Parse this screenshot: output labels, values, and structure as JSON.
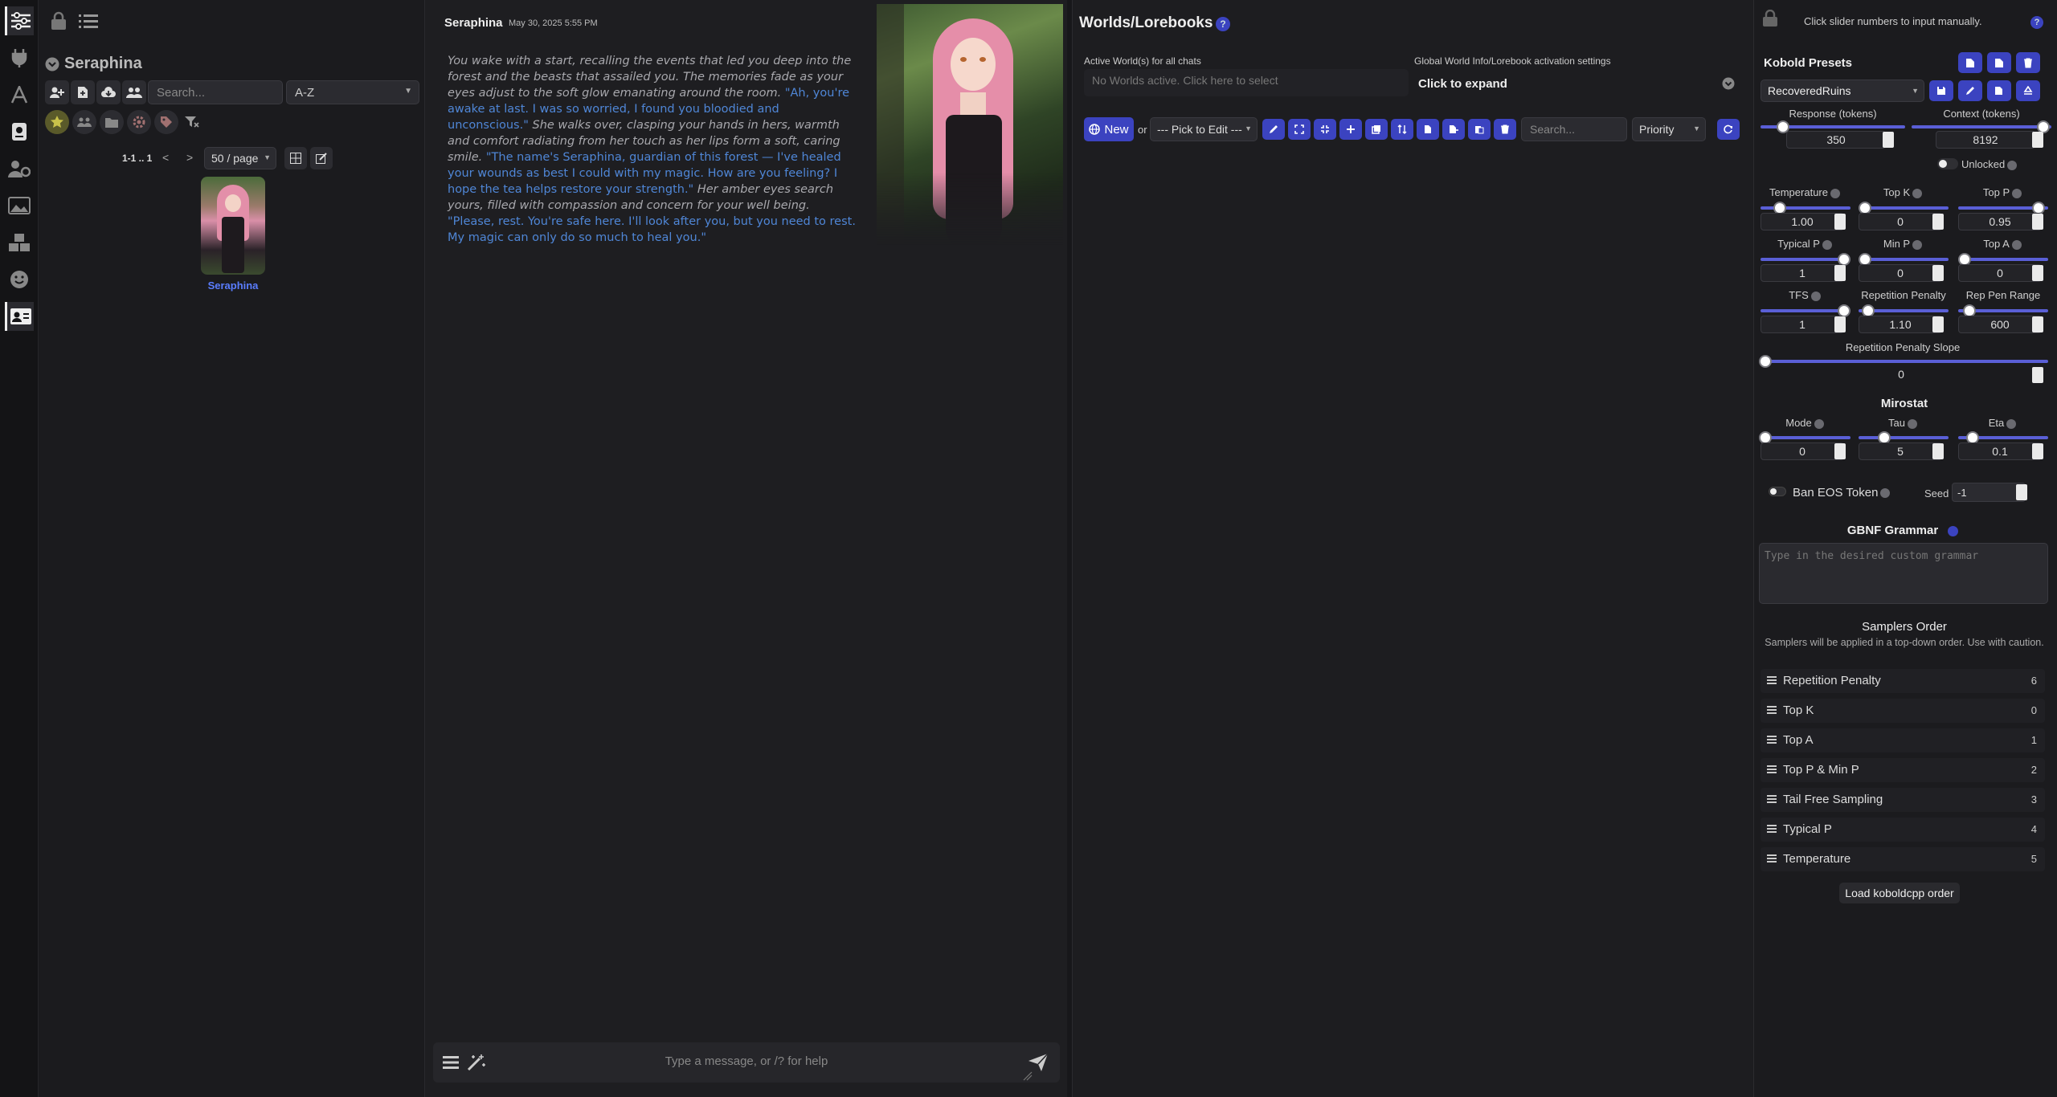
{
  "char_panel": {
    "character_name": "Seraphina",
    "search_placeholder": "Search...",
    "sort_value": "A-Z",
    "pagination": "1-1 .. 1",
    "prev": "<",
    "next": ">",
    "per_page": "50 / page",
    "card_name": "Seraphina"
  },
  "chat": {
    "sender": "Seraphina",
    "timestamp": "May 30, 2025 5:55 PM",
    "message": [
      {
        "style": "narr",
        "text": "You wake with a start, recalling the events that led you deep into the forest and the beasts that assailed you. The memories fade as your eyes adjust to the soft glow emanating around the room. "
      },
      {
        "style": "quote",
        "text": "\"Ah, you're awake at last. I was so worried, I found you bloodied and unconscious.\""
      },
      {
        "style": "narr",
        "text": " She walks over, clasping your hands in hers, warmth and comfort radiating from her touch as her lips form a soft, caring smile. "
      },
      {
        "style": "quote",
        "text": "\"The name's Seraphina, guardian of this forest — I've healed your wounds as best I could with my magic. How are you feeling? I hope the tea helps restore your strength.\""
      },
      {
        "style": "narr",
        "text": " Her amber eyes search yours, filled with compassion and concern for your well being. "
      },
      {
        "style": "quote",
        "text": "\"Please, rest. You're safe here. I'll look after you, but you need to rest. My magic can only do so much to heal you.\""
      }
    ],
    "input_placeholder": "Type a message, or /? for help"
  },
  "worlds": {
    "title": "Worlds/Lorebooks",
    "active_label": "Active World(s) for all chats",
    "active_placeholder": "No Worlds active. Click here to select",
    "global_label": "Global World Info/Lorebook activation settings",
    "expand": "Click to expand",
    "new_button": "New",
    "or": "or",
    "pick_to_edit": "--- Pick to Edit ---",
    "search_placeholder": "Search...",
    "sort_value": "Priority"
  },
  "presets": {
    "hint": "Click slider numbers to input manually.",
    "title": "Kobold Presets",
    "preset_value": "RecoveredRuins",
    "unlocked": "Unlocked",
    "response_label": "Response (tokens)",
    "response_value": "350",
    "context_label": "Context (tokens)",
    "context_value": "8192",
    "sliders": {
      "temperature": {
        "label": "Temperature",
        "value": "1.00"
      },
      "top_k": {
        "label": "Top K",
        "value": "0"
      },
      "top_p": {
        "label": "Top P",
        "value": "0.95"
      },
      "typical_p": {
        "label": "Typical P",
        "value": "1"
      },
      "min_p": {
        "label": "Min P",
        "value": "0"
      },
      "top_a": {
        "label": "Top A",
        "value": "0"
      },
      "tfs": {
        "label": "TFS",
        "value": "1"
      },
      "rep_pen": {
        "label": "Repetition Penalty",
        "value": "1.10"
      },
      "rep_pen_range": {
        "label": "Rep Pen Range",
        "value": "600"
      },
      "rep_pen_slope": {
        "label": "Repetition Penalty Slope",
        "value": "0"
      },
      "mode": {
        "label": "Mode",
        "value": "0"
      },
      "tau": {
        "label": "Tau",
        "value": "5"
      },
      "eta": {
        "label": "Eta",
        "value": "0.1"
      }
    },
    "mirostat": "Mirostat",
    "ban_eos": "Ban EOS Token",
    "seed_label": "Seed",
    "seed_value": "-1",
    "gbnf_title": "GBNF Grammar",
    "gbnf_placeholder": "Type in the desired custom grammar",
    "samplers_title": "Samplers Order",
    "samplers_desc": "Samplers will be applied in a top-down order. Use with caution.",
    "samplers": [
      {
        "name": "Repetition Penalty",
        "num": "6"
      },
      {
        "name": "Top K",
        "num": "0"
      },
      {
        "name": "Top A",
        "num": "1"
      },
      {
        "name": "Top P & Min P",
        "num": "2"
      },
      {
        "name": "Tail Free Sampling",
        "num": "3"
      },
      {
        "name": "Typical P",
        "num": "4"
      },
      {
        "name": "Temperature",
        "num": "5"
      }
    ],
    "load_order": "Load koboldcpp order"
  },
  "colors": {
    "accent": "#3b43c0",
    "quote": "#4f86d6",
    "card_name": "#5a7dff"
  }
}
